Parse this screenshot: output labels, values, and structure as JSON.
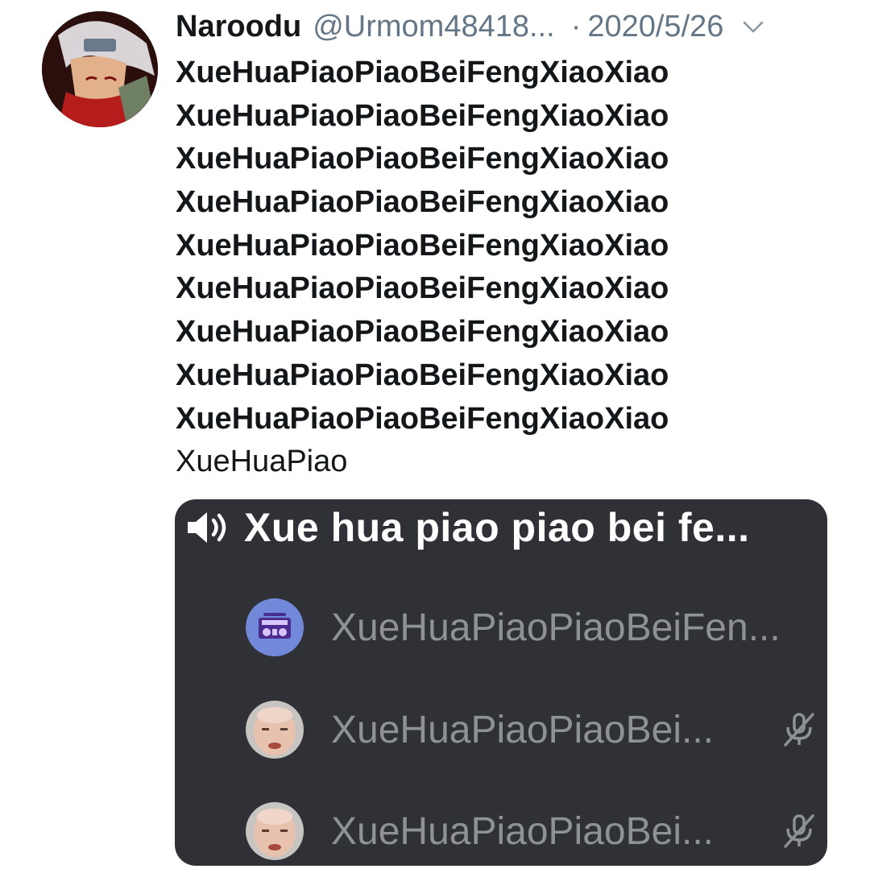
{
  "tweet": {
    "display_name": "Naroodu",
    "handle": "@Urmom48418...",
    "separator": "·",
    "date": "2020/5/26",
    "body_lines": [
      "XueHuaPiaoPiaoBeiFengXiaoXiao",
      "XueHuaPiaoPiaoBeiFengXiaoXiao",
      "XueHuaPiaoPiaoBeiFengXiaoXiao",
      "XueHuaPiaoPiaoBeiFengXiaoXiao",
      "XueHuaPiaoPiaoBeiFengXiaoXiao",
      "XueHuaPiaoPiaoBeiFengXiaoXiao",
      "XueHuaPiaoPiaoBeiFengXiaoXiao",
      "XueHuaPiaoPiaoBeiFengXiaoXiao",
      "XueHuaPiaoPiaoBeiFengXiaoXiao"
    ],
    "body_last_line": "XueHuaPiao"
  },
  "voice_channel": {
    "title": "Xue hua piao piao bei fe...",
    "members": [
      {
        "name": "XueHuaPiaoPiaoBeiFen...",
        "avatar": "boombox-icon",
        "muted": false
      },
      {
        "name": "XueHuaPiaoPiaoBei...",
        "avatar": "bald-man-photo",
        "muted": true
      },
      {
        "name": "XueHuaPiaoPiaoBei...",
        "avatar": "bald-man-photo",
        "muted": true
      }
    ]
  },
  "colors": {
    "text_primary": "#14171a",
    "text_secondary": "#657786",
    "card_bg": "#2f3136",
    "member_text": "#8e9297",
    "bot_avatar_bg": "#7289da"
  }
}
